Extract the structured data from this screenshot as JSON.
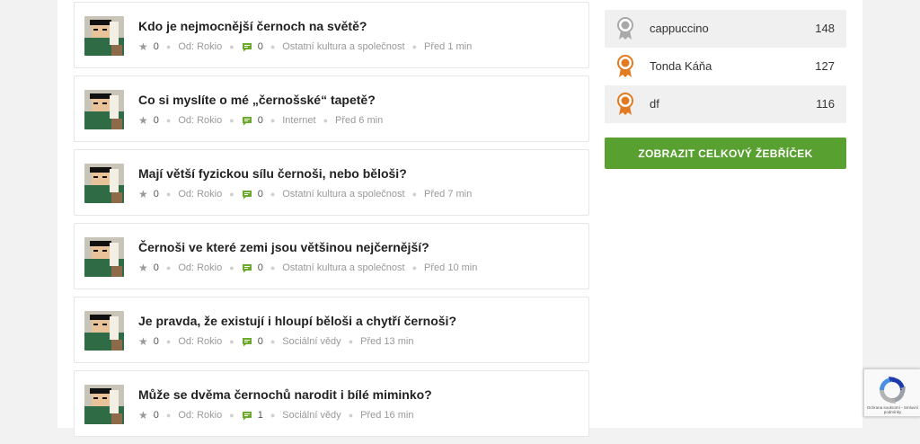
{
  "questions": [
    {
      "title": "Kdo je nejmocnější černoch na světě?",
      "votes": "0",
      "author": "Od: Rokio",
      "comments": "0",
      "category": "Ostatní kultura a společnost",
      "time": "Před 1 min"
    },
    {
      "title": "Co si myslíte o mé „černošské“ tapetě?",
      "votes": "0",
      "author": "Od: Rokio",
      "comments": "0",
      "category": "Internet",
      "time": "Před 6 min"
    },
    {
      "title": "Mají větší fyzickou sílu černoši, nebo běloši?",
      "votes": "0",
      "author": "Od: Rokio",
      "comments": "0",
      "category": "Ostatní kultura a společnost",
      "time": "Před 7 min"
    },
    {
      "title": "Černoši ve které zemi jsou většinou nejčernější?",
      "votes": "0",
      "author": "Od: Rokio",
      "comments": "0",
      "category": "Ostatní kultura a společnost",
      "time": "Před 10 min"
    },
    {
      "title": "Je pravda, že existují i hloupí běloši a chytří černoši?",
      "votes": "0",
      "author": "Od: Rokio",
      "comments": "0",
      "category": "Sociální vědy",
      "time": "Před 13 min"
    },
    {
      "title": "Může se dvěma černochů narodit i bílé miminko?",
      "votes": "0",
      "author": "Od: Rokio",
      "comments": "1",
      "category": "Sociální vědy",
      "time": "Před 16 min"
    }
  ],
  "leaderboard": {
    "rows": [
      {
        "name": "cappuccino",
        "score": "148",
        "medal": "silver-medal-icon"
      },
      {
        "name": "Tonda Káňa",
        "score": "127",
        "medal": "bronze-medal-icon"
      },
      {
        "name": "df",
        "score": "116",
        "medal": "bronze-medal-icon"
      }
    ],
    "button_label": "ZOBRAZIT CELKOVÝ ŽEBŘÍČEK"
  },
  "recaptcha": {
    "text": "Ochrana soukromí - Smluvní podmínky"
  },
  "colors": {
    "accent_green": "#58a02f",
    "comment_icon_green": "#6aab2e",
    "silver_medal": "#a9a9a9",
    "bronze_medal": "#e07b22"
  }
}
